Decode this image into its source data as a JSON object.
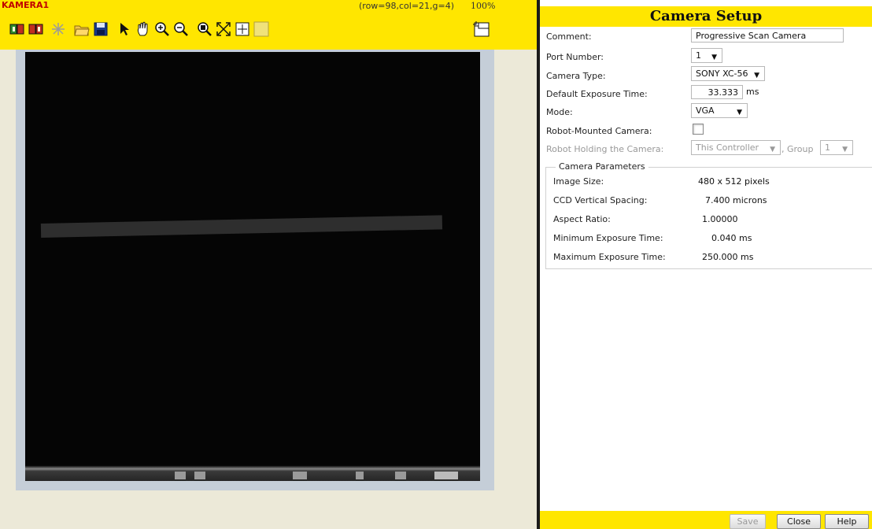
{
  "image_pane": {
    "title": "KAMERA1",
    "coords": "(row=98,col=21,g=4)",
    "zoom": "100%",
    "tools": [
      "snap-icon",
      "live-icon",
      "flash-icon",
      "open-icon",
      "save-icon",
      "pointer-icon",
      "pan-icon",
      "zoom-in-icon",
      "zoom-out-icon",
      "zoom-box-icon",
      "fit-icon",
      "grid-icon",
      "blank-icon"
    ]
  },
  "setup": {
    "header": "Camera Setup",
    "comment_label": "Comment:",
    "comment_value": "Progressive Scan Camera",
    "port_label": "Port Number:",
    "port_value": "1",
    "type_label": "Camera Type:",
    "type_value": "SONY XC-56",
    "exposure_label": "Default Exposure Time:",
    "exposure_value": "33.333",
    "exposure_unit": "ms",
    "mode_label": "Mode:",
    "mode_value": "VGA",
    "robot_mounted_label": "Robot-Mounted Camera:",
    "robot_holding_label": "Robot Holding the Camera:",
    "robot_holding_value": "This Controller",
    "group_label": ", Group",
    "group_value": "1",
    "params_legend": "Camera Parameters",
    "params": [
      {
        "label": "Image Size:",
        "value": "480 x 512 pixels"
      },
      {
        "label": "CCD Vertical Spacing:",
        "value": "7.400 microns"
      },
      {
        "label": "Aspect Ratio:",
        "value": "1.00000"
      },
      {
        "label": "Minimum Exposure Time:",
        "value": "0.040 ms"
      },
      {
        "label": "Maximum Exposure Time:",
        "value": "250.000 ms"
      }
    ]
  },
  "footer": {
    "save": "Save",
    "close": "Close",
    "help": "Help"
  }
}
